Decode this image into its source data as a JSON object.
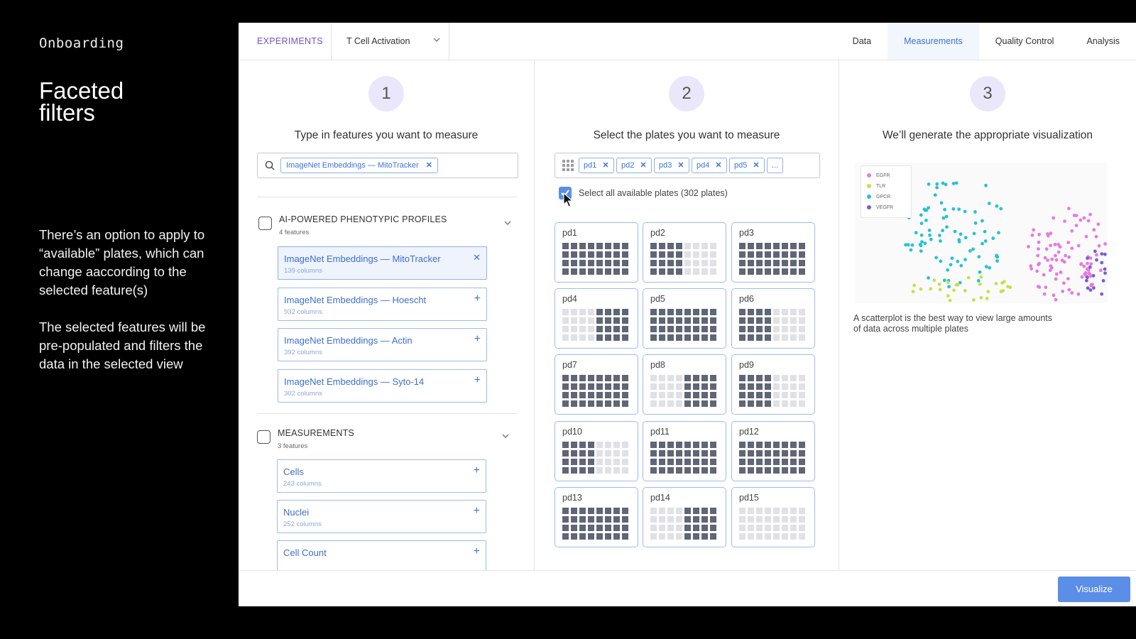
{
  "slide": {
    "section": "Onboarding",
    "title": "Faceted filters",
    "desc1": "There’s an option to apply to “available” plates, which can change aaccording to the selected feature(s)",
    "desc2": "The selected features will be pre-populated and filters the data in the selected view"
  },
  "topbar": {
    "crumb": "EXPERIMENTS",
    "experiment": "T Cell Activation",
    "tabs": [
      "Data",
      "Measurements",
      "Quality Control",
      "Analysis"
    ],
    "active_tab": "Measurements"
  },
  "step1": {
    "number": "1",
    "title": "Type in features you want to measure",
    "search_chip": "ImageNet Embeddings — MitoTracker",
    "categories": [
      {
        "title": "AI-POWERED PHENOTYPIC PROFILES",
        "count": "4 features",
        "features": [
          {
            "name": "ImageNet Embeddings — MitoTracker",
            "columns": "139 columns",
            "selected": true
          },
          {
            "name": "ImageNet Embeddings — Hoescht",
            "columns": "932 columns",
            "selected": false
          },
          {
            "name": "ImageNet Embeddings — Actin",
            "columns": "392 columns",
            "selected": false
          },
          {
            "name": "ImageNet Embeddings — Syto-14",
            "columns": "302 columns",
            "selected": false
          }
        ]
      },
      {
        "title": "MEASUREMENTS",
        "count": "3 features",
        "features": [
          {
            "name": "Cells",
            "columns": "243 columns",
            "selected": false
          },
          {
            "name": "Nuclei",
            "columns": "252 columns",
            "selected": false
          },
          {
            "name": "Cell Count",
            "columns": "",
            "selected": false
          }
        ]
      }
    ]
  },
  "step2": {
    "number": "2",
    "title": "Select the plates you want to measure",
    "chips": [
      "pd1",
      "pd2",
      "pd3",
      "pd4",
      "pd5"
    ],
    "more": "...",
    "select_all_label": "Select all available plates (302 plates)",
    "select_all_checked": true,
    "plates": [
      {
        "name": "pd1",
        "pattern": "full"
      },
      {
        "name": "pd2",
        "pattern": "left4"
      },
      {
        "name": "pd3",
        "pattern": "full"
      },
      {
        "name": "pd4",
        "pattern": "right4"
      },
      {
        "name": "pd5",
        "pattern": "full"
      },
      {
        "name": "pd6",
        "pattern": "left4"
      },
      {
        "name": "pd7",
        "pattern": "full"
      },
      {
        "name": "pd8",
        "pattern": "right4"
      },
      {
        "name": "pd9",
        "pattern": "left4"
      },
      {
        "name": "pd10",
        "pattern": "left4"
      },
      {
        "name": "pd11",
        "pattern": "full"
      },
      {
        "name": "pd12",
        "pattern": "full"
      },
      {
        "name": "pd13",
        "pattern": "full"
      },
      {
        "name": "pd14",
        "pattern": "right4"
      },
      {
        "name": "pd15",
        "pattern": "empty"
      }
    ]
  },
  "step3": {
    "number": "3",
    "title": "We’ll generate the appropriate visualization",
    "legend": [
      {
        "label": "EGFR",
        "color": "#e77ae0"
      },
      {
        "label": "TLR",
        "color": "#c8e04a"
      },
      {
        "label": "GPCR",
        "color": "#27c3cf"
      },
      {
        "label": "VEGFR",
        "color": "#7c5ad6"
      }
    ],
    "caption": "A scatterplot is the best way to view large amounts of data across multiple plates"
  },
  "footer": {
    "button": "Visualize"
  },
  "colors": {
    "accent": "#5b8ee6",
    "link": "#3d73d6",
    "purple": "#7a4fcf",
    "well": "#5f6675",
    "well_off": "#dfe1e6"
  }
}
